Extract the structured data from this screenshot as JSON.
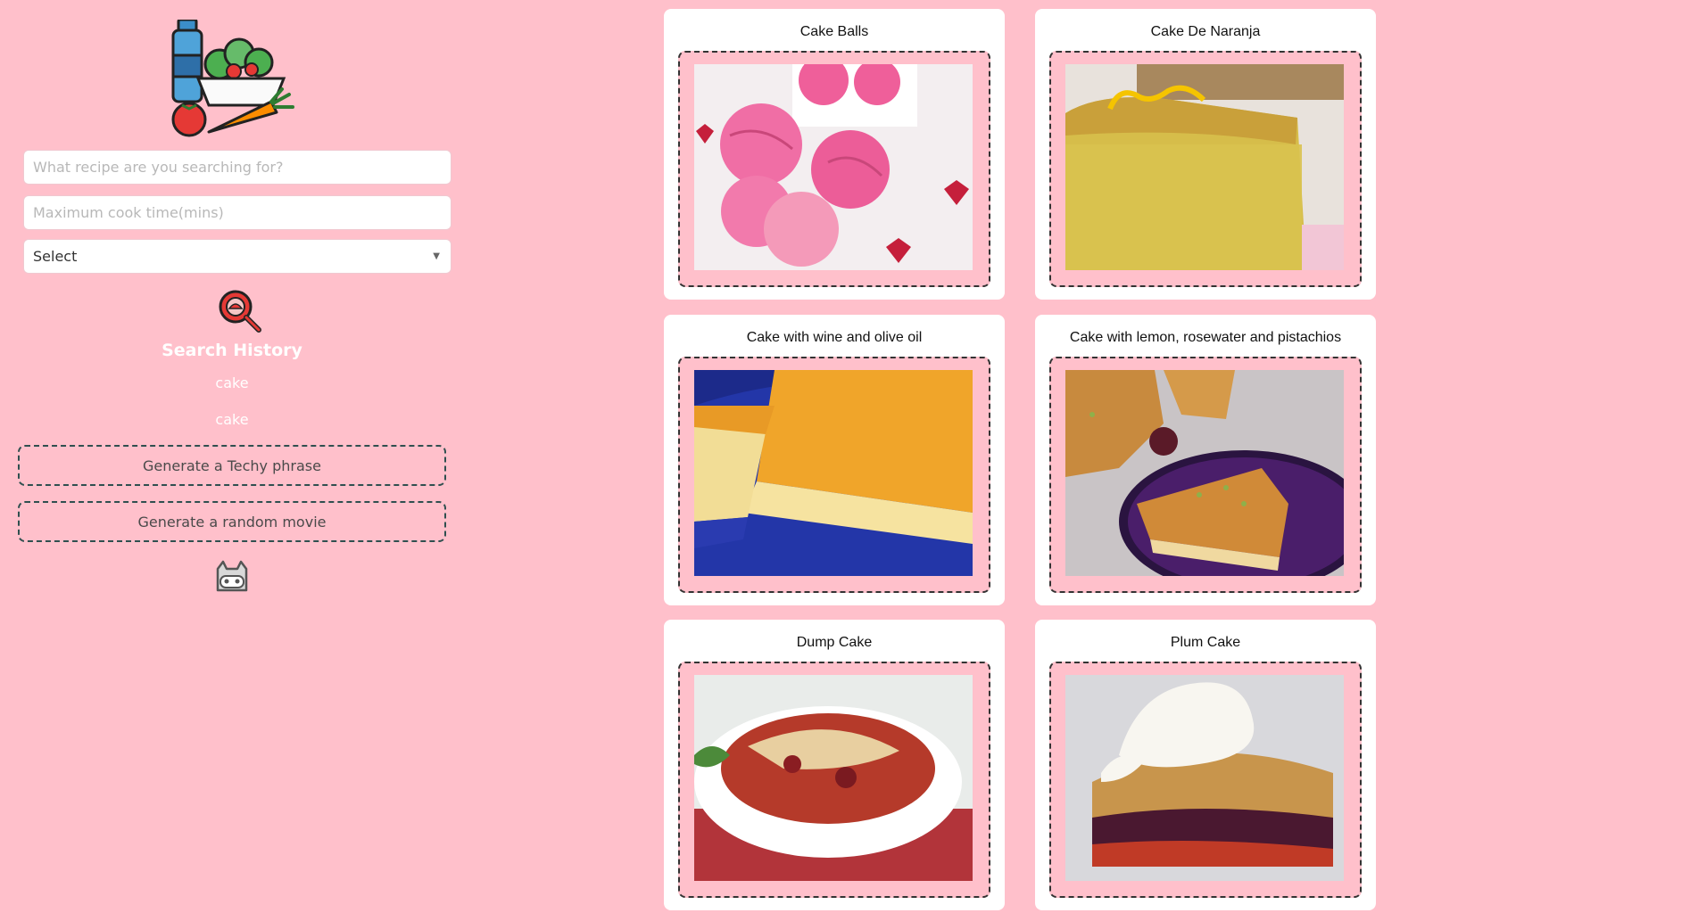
{
  "sidebar": {
    "logo_icon": "grocery-logo-icon",
    "recipe_search": {
      "placeholder": "What recipe are you searching for?"
    },
    "cook_time": {
      "placeholder": "Maximum cook time(mins)"
    },
    "select": {
      "value": "Select"
    },
    "search_icon": "magnifier-icon",
    "history": {
      "title": "Search History",
      "items": [
        "cake",
        "cake"
      ]
    },
    "techy_button": "Generate a Techy phrase",
    "movie_button": "Generate a random movie",
    "github_icon": "github-icon"
  },
  "recipes": [
    {
      "title": "Cake Balls",
      "image_icon": "cake-balls-image"
    },
    {
      "title": "Cake De Naranja",
      "image_icon": "orange-cake-image"
    },
    {
      "title": "Cake with wine and olive oil",
      "image_icon": "wine-olive-cake-image"
    },
    {
      "title": "Cake with lemon, rosewater and pistachios",
      "image_icon": "lemon-pistachio-cake-image"
    },
    {
      "title": "Dump Cake",
      "image_icon": "dump-cake-image"
    },
    {
      "title": "Plum Cake",
      "image_icon": "plum-cake-image"
    }
  ],
  "colors": {
    "background": "#ffc0cb",
    "card": "#ffffff",
    "dash_border": "#2f4f4f",
    "history_text": "#ffffff"
  }
}
